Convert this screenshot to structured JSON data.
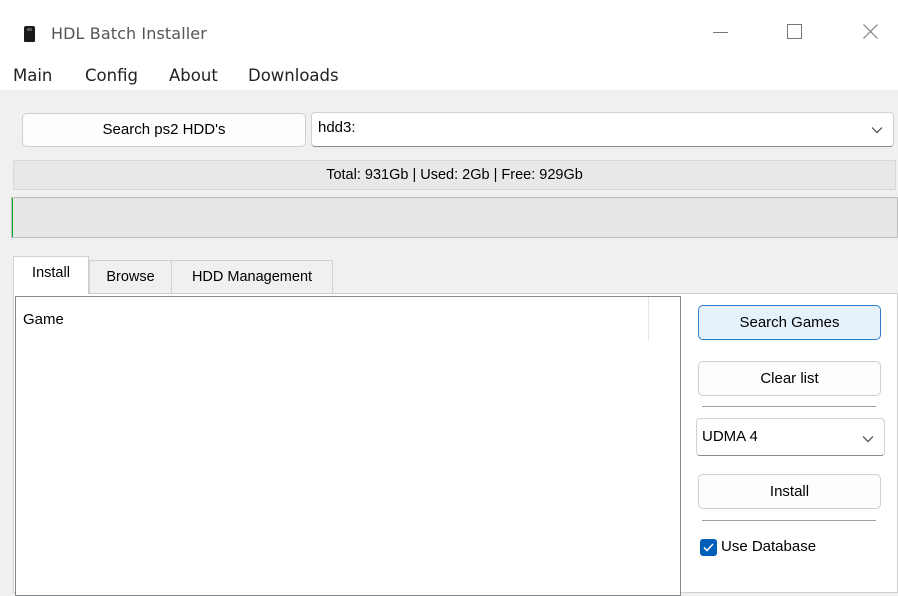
{
  "window": {
    "title": "HDL Batch Installer",
    "icon": "app-icon",
    "controls": [
      "minimize-icon",
      "maximize-icon",
      "close-icon"
    ]
  },
  "menu": {
    "items": [
      "Main",
      "Config",
      "About",
      "Downloads"
    ]
  },
  "toolbar": {
    "search_hdd_label": "Search ps2 HDD's",
    "hdd_selected": "hdd3:"
  },
  "status": {
    "text": "Total: 931Gb | Used: 2Gb | Free: 929Gb"
  },
  "progress": {
    "percent": 0
  },
  "tabs": [
    {
      "label": "Install",
      "active": true
    },
    {
      "label": "Browse",
      "active": false
    },
    {
      "label": "HDD Management",
      "active": false
    }
  ],
  "install": {
    "list": {
      "columns": [
        "Game"
      ],
      "rows": []
    },
    "search_games_label": "Search Games",
    "clear_list_label": "Clear list",
    "udma_selected": "UDMA 4",
    "install_label": "Install",
    "use_database_label": "Use Database",
    "use_database_checked": true
  },
  "colors": {
    "accent": "#005fb8",
    "focus_border": "#2f7fd1",
    "progress_green": "#06b025"
  }
}
